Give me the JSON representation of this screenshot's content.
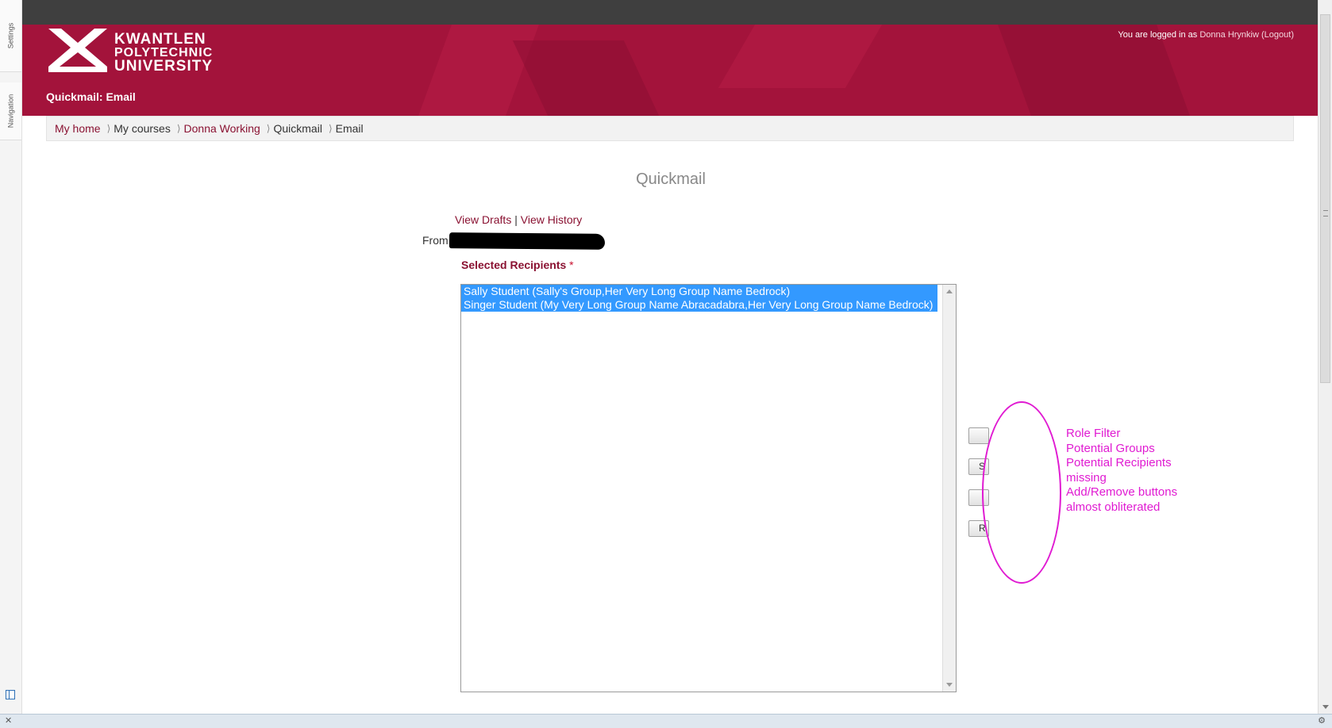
{
  "dock": {
    "settings_label": "Settings",
    "navigation_label": "Navigation"
  },
  "header": {
    "logo": {
      "line1": "KWANTLEN",
      "line2": "POLYTECHNIC",
      "line3": "UNIVERSITY"
    },
    "page_heading": "Quickmail: Email",
    "login": {
      "prefix": "You are logged in as",
      "user_name": "Donna Hrynkiw",
      "logout": "(Logout)"
    }
  },
  "breadcrumb": {
    "items": [
      "My home",
      "My courses",
      "Donna Working",
      "Quickmail",
      "Email"
    ],
    "separator": "⟩"
  },
  "main": {
    "title": "Quickmail",
    "view_drafts": "View Drafts",
    "divider": "|",
    "view_history": "View History",
    "from_label": "From",
    "selected_recipients_label": "Selected Recipients",
    "required_mark": "*",
    "recipients": [
      "Sally Student (Sally's Group,Her Very Long Group Name Bedrock)",
      "Singer Student (My Very Long Group Name Abracadabra,Her Very Long Group Name Bedrock)"
    ],
    "buttons": [
      "",
      "S",
      "",
      "R"
    ]
  },
  "annotation": {
    "color": "#e01bd2",
    "lines": [
      "Role Filter",
      "Potential Groups",
      "Potential Recipients",
      "missing",
      "Add/Remove buttons",
      "almost obliterated"
    ]
  },
  "statusbar": {
    "close_glyph": "✕",
    "plugin_icon": "plugin-icon"
  },
  "colors": {
    "brand": "#a3133b",
    "link": "#8a1232",
    "selection": "#3399ff"
  }
}
